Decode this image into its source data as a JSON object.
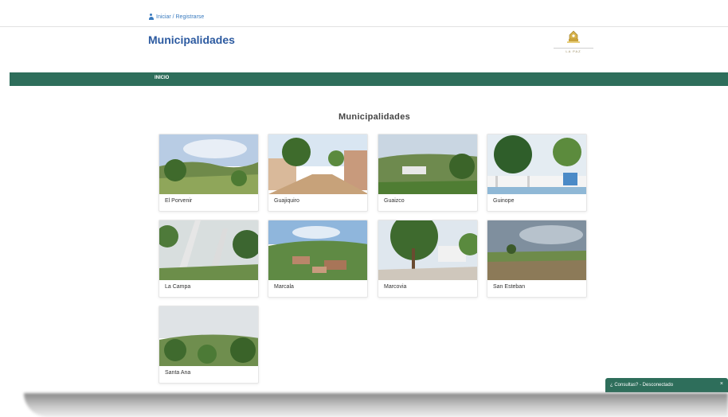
{
  "header": {
    "login_text": "Iniciar / Registrarse",
    "page_title": "Municipalidades",
    "logo_caption": "LA PAZ"
  },
  "nav": {
    "items": [
      {
        "label": "INICIO"
      }
    ]
  },
  "main": {
    "section_title": "Municipalidades",
    "municipalities": [
      {
        "name": "El Porvenir"
      },
      {
        "name": "Guajiquiro"
      },
      {
        "name": "Guaizco"
      },
      {
        "name": "Guinope"
      },
      {
        "name": "La Campa"
      },
      {
        "name": "Marcala"
      },
      {
        "name": "Marcovia"
      },
      {
        "name": "San Esteban"
      },
      {
        "name": "Santa Ana"
      }
    ]
  },
  "chat": {
    "label": "¿ Consultas? - Desconectado",
    "close": "×"
  },
  "colors": {
    "brand_green": "#2e6e5b",
    "title_blue": "#2c5aa0"
  }
}
